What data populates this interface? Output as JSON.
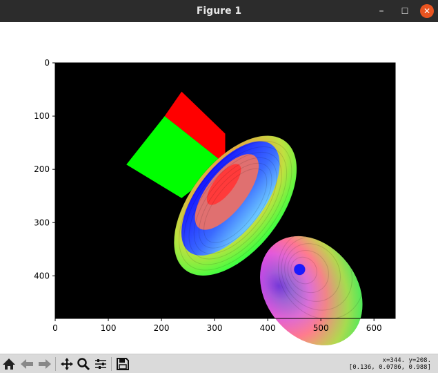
{
  "window": {
    "title": "Figure 1",
    "minimize_glyph": "–",
    "maximize_glyph": "☐",
    "close_glyph": "✕"
  },
  "toolbar": {
    "buttons": [
      {
        "icon": "home-icon"
      },
      {
        "icon": "back-arrow-icon"
      },
      {
        "icon": "forward-arrow-icon"
      },
      {
        "icon": "pan-move-icon"
      },
      {
        "icon": "zoom-magnifier-icon"
      },
      {
        "icon": "configure-subplots-icon"
      },
      {
        "icon": "save-floppy-icon"
      }
    ],
    "coords_line1": "x=344. y=208.",
    "coords_line2": "[0.136, 0.0786, 0.988]"
  },
  "chart_data": {
    "type": "image",
    "background": "#000000",
    "xlim": [
      0,
      640
    ],
    "ylim": [
      480,
      0
    ],
    "xticks": [
      "0",
      "100",
      "200",
      "300",
      "400",
      "500",
      "600"
    ],
    "yticks": [
      "0",
      "100",
      "200",
      "300",
      "400"
    ],
    "objects": [
      {
        "name": "red-face",
        "shape": "polygon",
        "color": "#ff0000",
        "points": [
          [
            206,
            100
          ],
          [
            238,
            54
          ],
          [
            320,
            133
          ],
          [
            320,
            190
          ]
        ]
      },
      {
        "name": "green-face",
        "shape": "polygon",
        "color": "#00ff00",
        "points": [
          [
            134,
            191
          ],
          [
            206,
            100
          ],
          [
            320,
            190
          ],
          [
            238,
            254
          ]
        ]
      },
      {
        "name": "torus",
        "shape": "torus",
        "colors": [
          "#2a2aff",
          "#ff2a2a",
          "#ffd000",
          "#2aff2a"
        ]
      },
      {
        "name": "ellipsoid",
        "shape": "ellipsoid",
        "colors": [
          "#ff00ff",
          "#5a5aff",
          "#ffe000",
          "#00e060"
        ]
      }
    ]
  }
}
